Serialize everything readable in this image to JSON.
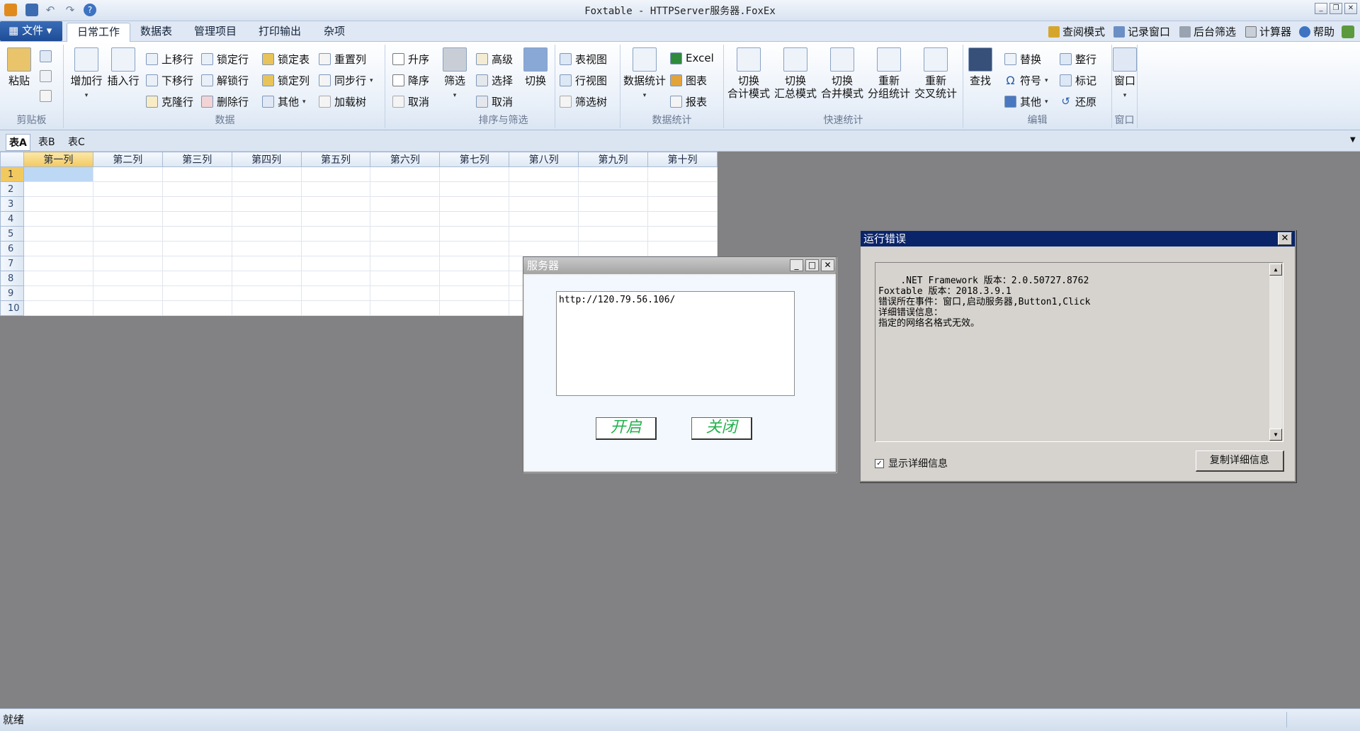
{
  "window": {
    "title": "Foxtable - HTTPServer服务器.FoxEx"
  },
  "menu": {
    "file": "文件",
    "tabs": [
      "日常工作",
      "数据表",
      "管理项目",
      "打印输出",
      "杂项"
    ],
    "right": [
      "查阅模式",
      "记录窗口",
      "后台筛选",
      "计算器",
      "帮助"
    ]
  },
  "ribbon": {
    "clipboard": {
      "label": "剪贴板",
      "paste": "粘贴"
    },
    "data": {
      "label": "数据",
      "add_row": "增加行",
      "insert_row": "插入行",
      "move_up": "上移行",
      "move_down": "下移行",
      "clone_row": "克隆行",
      "lock_row": "锁定行",
      "unlock_row": "解锁行",
      "delete_row": "删除行",
      "lock_table": "锁定表",
      "lock_col": "锁定列",
      "other": "其他",
      "reset_col": "重置列",
      "sync_row": "同步行",
      "load_tree": "加载树"
    },
    "sort": {
      "label": "排序与筛选",
      "asc": "升序",
      "desc": "降序",
      "cancel": "取消",
      "filter": "筛选",
      "advanced": "高级",
      "select": "选择",
      "cancel2": "取消",
      "switch": "切换",
      "table_view": "表视图",
      "row_view": "行视图",
      "filter_tree": "筛选树"
    },
    "stats": {
      "label": "数据统计",
      "data_stats": "数据统计",
      "excel": "Excel",
      "chart": "图表",
      "report": "报表"
    },
    "quick": {
      "label": "快速统计",
      "b1": [
        "切换",
        "合计模式"
      ],
      "b2": [
        "切换",
        "汇总模式"
      ],
      "b3": [
        "切换",
        "合并模式"
      ],
      "b4": [
        "重新",
        "分组统计"
      ],
      "b5": [
        "重新",
        "交叉统计"
      ]
    },
    "edit": {
      "label": "编辑",
      "find": "查找",
      "replace": "替换",
      "symbol": "符号",
      "other": "其他",
      "tidy_row": "整行",
      "mark": "标记",
      "restore": "还原"
    },
    "window": {
      "label": "窗口",
      "window": "窗口"
    }
  },
  "sheets": [
    "表A",
    "表B",
    "表C"
  ],
  "grid": {
    "columns": [
      "第一列",
      "第二列",
      "第三列",
      "第四列",
      "第五列",
      "第六列",
      "第七列",
      "第八列",
      "第九列",
      "第十列"
    ],
    "rows": [
      "1",
      "2",
      "3",
      "4",
      "5",
      "6",
      "7",
      "8",
      "9",
      "10"
    ]
  },
  "server_window": {
    "title": "服务器",
    "url": "http://120.79.56.106/",
    "start": "开启",
    "close": "关闭"
  },
  "error_window": {
    "title": "运行错误",
    "text": ".NET Framework 版本：2.0.50727.8762\nFoxtable 版本：2018.3.9.1\n错误所在事件：窗口,启动服务器,Button1,Click\n详细错误信息：\n指定的网络名格式无效。",
    "show_details": "显示详细信息",
    "copy_details": "复制详细信息"
  },
  "status": {
    "text": "就绪"
  }
}
